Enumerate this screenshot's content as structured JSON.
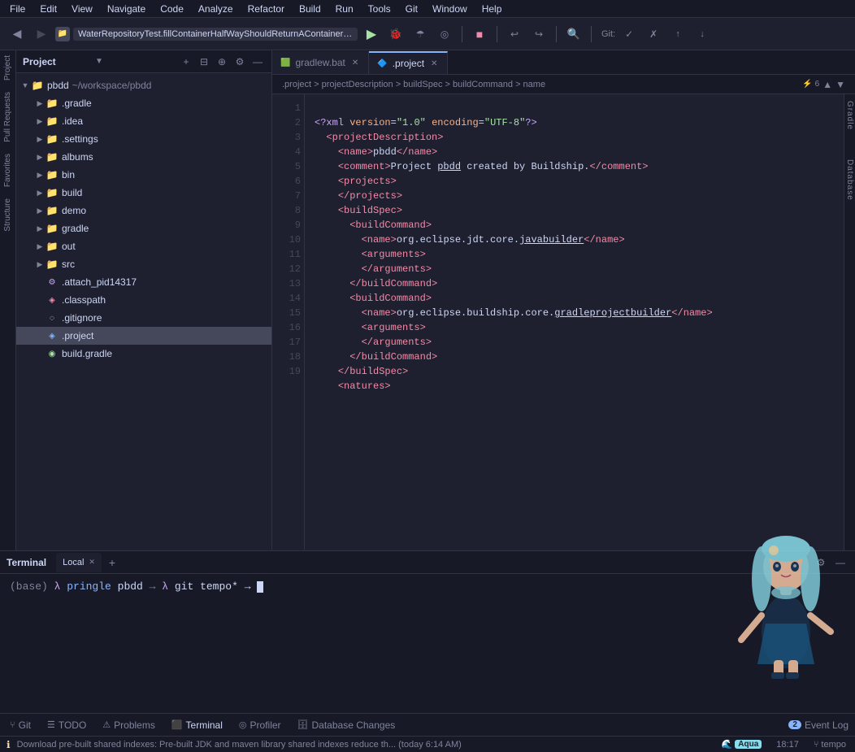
{
  "menu": {
    "items": [
      "File",
      "Edit",
      "View",
      "Navigate",
      "Code",
      "Analyze",
      "Refactor",
      "Build",
      "Run",
      "Tools",
      "Git",
      "Window",
      "Help"
    ]
  },
  "toolbar": {
    "run_config": "WaterRepositoryTest.fillContainerHalfWayShouldReturnAContainerThatIsHalfFull",
    "git_label": "Git:",
    "back_btn": "◀",
    "forward_btn": "▶"
  },
  "project_panel": {
    "title": "Project",
    "root": "pbdd",
    "root_path": "~/workspace/pbdd",
    "items": [
      {
        "label": ".gradle",
        "type": "folder-orange",
        "indent": 1,
        "expanded": false
      },
      {
        "label": ".idea",
        "type": "folder",
        "indent": 1,
        "expanded": false
      },
      {
        "label": ".settings",
        "type": "folder",
        "indent": 1,
        "expanded": false
      },
      {
        "label": "albums",
        "type": "folder",
        "indent": 1,
        "expanded": false
      },
      {
        "label": "bin",
        "type": "folder",
        "indent": 1,
        "expanded": false
      },
      {
        "label": "build",
        "type": "folder-orange",
        "indent": 1,
        "expanded": false
      },
      {
        "label": "demo",
        "type": "folder",
        "indent": 1,
        "expanded": false
      },
      {
        "label": "gradle",
        "type": "folder",
        "indent": 1,
        "expanded": false
      },
      {
        "label": "out",
        "type": "folder",
        "indent": 1,
        "expanded": false
      },
      {
        "label": "src",
        "type": "folder",
        "indent": 1,
        "expanded": false
      },
      {
        "label": ".attach_pid14317",
        "type": "attach",
        "indent": 1
      },
      {
        "label": ".classpath",
        "type": "classpath",
        "indent": 1
      },
      {
        "label": ".gitignore",
        "type": "gitignore",
        "indent": 1
      },
      {
        "label": ".project",
        "type": "project",
        "indent": 1,
        "selected": true
      },
      {
        "label": "build.gradle",
        "type": "gradle",
        "indent": 1
      }
    ]
  },
  "tabs": [
    {
      "label": "gradlew.bat",
      "type": "bat",
      "active": false,
      "closeable": true
    },
    {
      "label": ".project",
      "type": "project",
      "active": true,
      "closeable": true
    }
  ],
  "code": {
    "lines": [
      {
        "num": 1,
        "content": "<?xml version=\"1.0\" encoding=\"UTF-8\"?>"
      },
      {
        "num": 2,
        "content": "  <projectDescription>"
      },
      {
        "num": 3,
        "content": "    <name>pbdd</name>"
      },
      {
        "num": 4,
        "content": "    <comment>Project pbdd created by Buildship.</comment>"
      },
      {
        "num": 5,
        "content": "    <projects>"
      },
      {
        "num": 6,
        "content": "    </projects>"
      },
      {
        "num": 7,
        "content": "    <buildSpec>"
      },
      {
        "num": 8,
        "content": "      <buildCommand>"
      },
      {
        "num": 9,
        "content": "        <name>org.eclipse.jdt.core.javabuilder</name>"
      },
      {
        "num": 10,
        "content": "        <arguments>"
      },
      {
        "num": 11,
        "content": "        </arguments>"
      },
      {
        "num": 12,
        "content": "      </buildCommand>"
      },
      {
        "num": 13,
        "content": "      <buildCommand>"
      },
      {
        "num": 14,
        "content": "        <name>org.eclipse.buildship.core.gradleprojectbuilder</name>"
      },
      {
        "num": 15,
        "content": "        <arguments>"
      },
      {
        "num": 16,
        "content": "        </arguments>"
      },
      {
        "num": 17,
        "content": "      </buildCommand>"
      },
      {
        "num": 18,
        "content": "    </buildSpec>"
      },
      {
        "num": 19,
        "content": "    <natures>"
      }
    ],
    "breadcrumb": ".project > projectDescription > buildSpec > buildCommand > name"
  },
  "terminal": {
    "label": "Terminal",
    "tabs": [
      {
        "label": "Local",
        "active": true
      }
    ],
    "prompt": "(base) λ pringle pbdd → λ git tempo* → ",
    "cursor": "█"
  },
  "bottom_tabs": [
    {
      "label": "Git",
      "icon": "⑂",
      "active": false
    },
    {
      "label": "TODO",
      "icon": "☰",
      "active": false
    },
    {
      "label": "Problems",
      "icon": "⚠",
      "active": false
    },
    {
      "label": "Terminal",
      "icon": "⬛",
      "active": true
    },
    {
      "label": "Profiler",
      "icon": "◎",
      "active": false
    },
    {
      "label": "Database Changes",
      "icon": "🗄",
      "active": false
    }
  ],
  "event_log": {
    "badge": "2",
    "label": "Event Log"
  },
  "status_bar": {
    "message": "Download pre-built shared indexes: Pre-built JDK and maven library shared indexes reduce th... (today 6:14 AM)",
    "theme": "Aqua",
    "time": "18:17",
    "branch": "tempo"
  },
  "right_sidebar": {
    "labels": [
      "Gradle",
      "Database"
    ]
  },
  "left_vertical_labels": {
    "labels": [
      "Project",
      "Pull Requests",
      "Favorites",
      "Structure"
    ]
  },
  "colors": {
    "bg_dark": "#181926",
    "bg_main": "#1e2030",
    "accent_blue": "#89b4fa",
    "accent_green": "#a6e3a1",
    "accent_red": "#f38ba8",
    "accent_yellow": "#f9e2af",
    "accent_purple": "#cba6f7",
    "text_dim": "#7f849c",
    "text_normal": "#cdd6f4",
    "border": "#313244"
  }
}
